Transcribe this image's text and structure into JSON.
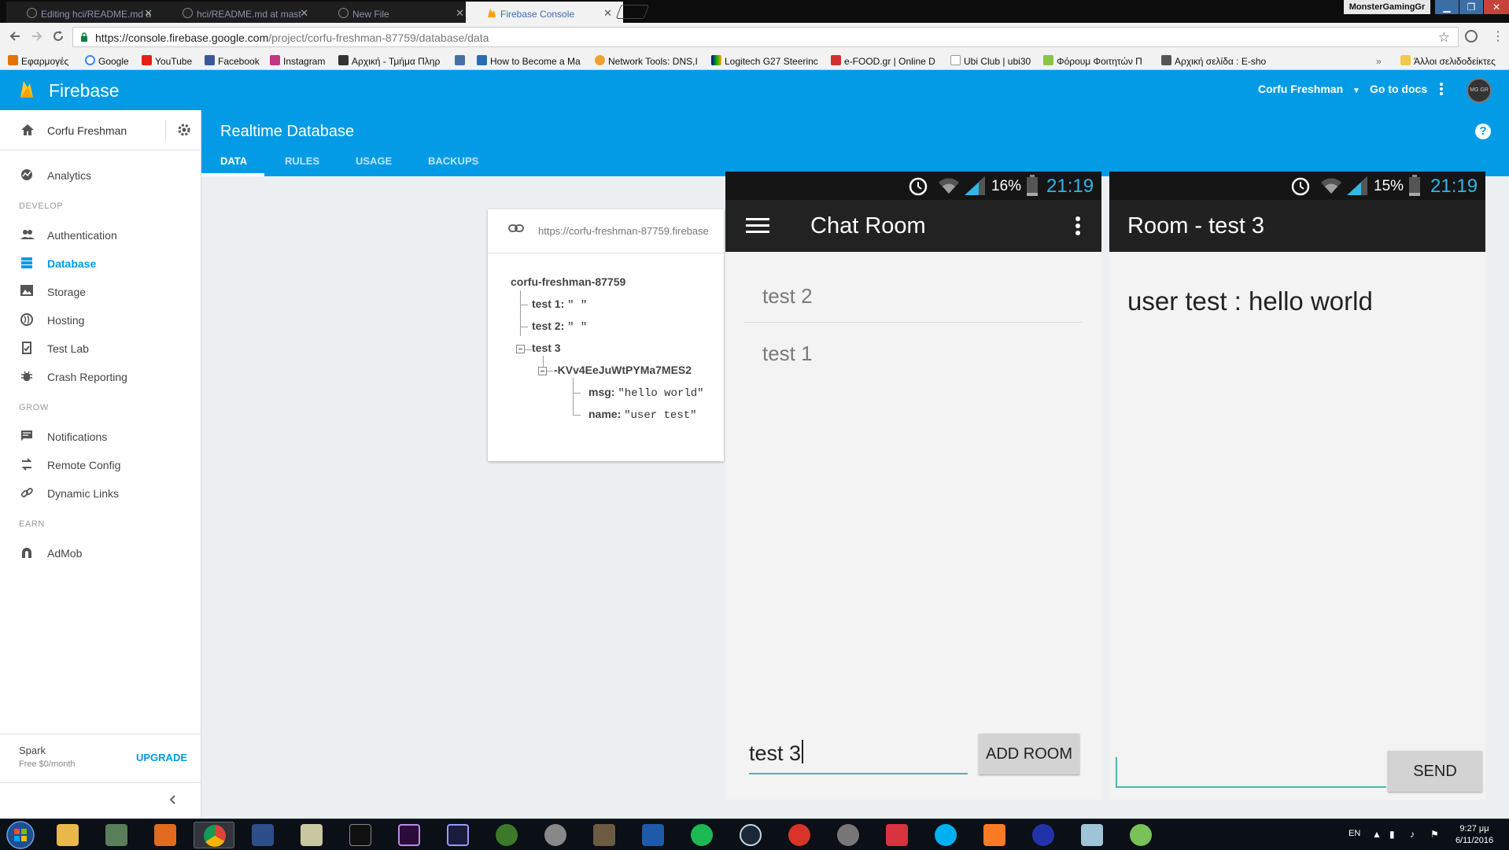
{
  "browser": {
    "tabs": [
      {
        "title": "Editing hci/README.md a"
      },
      {
        "title": "hci/README.md at mast"
      },
      {
        "title": "New File"
      },
      {
        "title": "Firebase Console"
      }
    ],
    "window_user": "MonsterGamingGr",
    "url_host": "https://console.firebase.google.com",
    "url_path": "/project/corfu-freshman-87759/database/data",
    "bookmarks": [
      {
        "label": "Εφαρμογές"
      },
      {
        "label": "Google"
      },
      {
        "label": "YouTube"
      },
      {
        "label": "Facebook"
      },
      {
        "label": "Instagram"
      },
      {
        "label": "Αρχική - Τμήμα Πληρ"
      },
      {
        "label": "How to Become a Ma"
      },
      {
        "label": "Network Tools: DNS,I"
      },
      {
        "label": "Logitech G27 Steerinc"
      },
      {
        "label": "e-FOOD.gr | Online D"
      },
      {
        "label": "Ubi Club | ubi30"
      },
      {
        "label": "Φόρουμ Φοιτητών Π"
      },
      {
        "label": "Αρχική σελίδα : E-sho"
      },
      {
        "label": "Άλλοι σελιδοδείκτες"
      }
    ]
  },
  "firebase": {
    "brand": "Firebase",
    "project_switcher": "Corfu Freshman",
    "go_to_docs": "Go to docs",
    "avatar_text": "MG GR",
    "sidebar": {
      "project": "Corfu Freshman",
      "analytics": "Analytics",
      "sections": {
        "develop": "DEVELOP",
        "grow": "GROW",
        "earn": "EARN"
      },
      "develop": [
        {
          "label": "Authentication"
        },
        {
          "label": "Database"
        },
        {
          "label": "Storage"
        },
        {
          "label": "Hosting"
        },
        {
          "label": "Test Lab"
        },
        {
          "label": "Crash Reporting"
        }
      ],
      "grow": [
        {
          "label": "Notifications"
        },
        {
          "label": "Remote Config"
        },
        {
          "label": "Dynamic Links"
        }
      ],
      "earn": [
        {
          "label": "AdMob"
        }
      ],
      "plan_name": "Spark",
      "plan_price": "Free $0/month",
      "upgrade": "UPGRADE"
    },
    "page_title": "Realtime Database",
    "tabs": [
      {
        "label": "DATA",
        "active": true
      },
      {
        "label": "RULES"
      },
      {
        "label": "USAGE"
      },
      {
        "label": "BACKUPS"
      }
    ],
    "help": "?",
    "db_url": "https://corfu-freshman-87759.firebase",
    "tree": {
      "root": "corfu-freshman-87759",
      "test1_key": "test 1:",
      "test1_val": "\" \"",
      "test2_key": "test 2:",
      "test2_val": "\" \"",
      "test3_key": "test 3",
      "push_id": "-KVv4EeJuWtPYMa7MES2",
      "msg_key": "msg:",
      "msg_val": "\"hello world\"",
      "name_key": "name:",
      "name_val": "\"user test\""
    }
  },
  "phone1": {
    "battery": "16%",
    "clock": "21:19",
    "title": "Chat Room",
    "rooms": [
      {
        "name": "test 2"
      },
      {
        "name": "test 1"
      }
    ],
    "input_value": "test 3",
    "add_button": "ADD ROOM"
  },
  "phone2": {
    "battery": "15%",
    "clock": "21:19",
    "title": "Room - test 3",
    "message": "user test : hello world",
    "input_value": "",
    "send_button": "SEND"
  },
  "taskbar": {
    "lang": "EN",
    "time": "9:27 μμ",
    "date": "6/11/2016"
  },
  "colors": {
    "firebase_blue": "#039be5",
    "android_accent": "#33b5e5",
    "input_underline": "#4db6ac"
  }
}
